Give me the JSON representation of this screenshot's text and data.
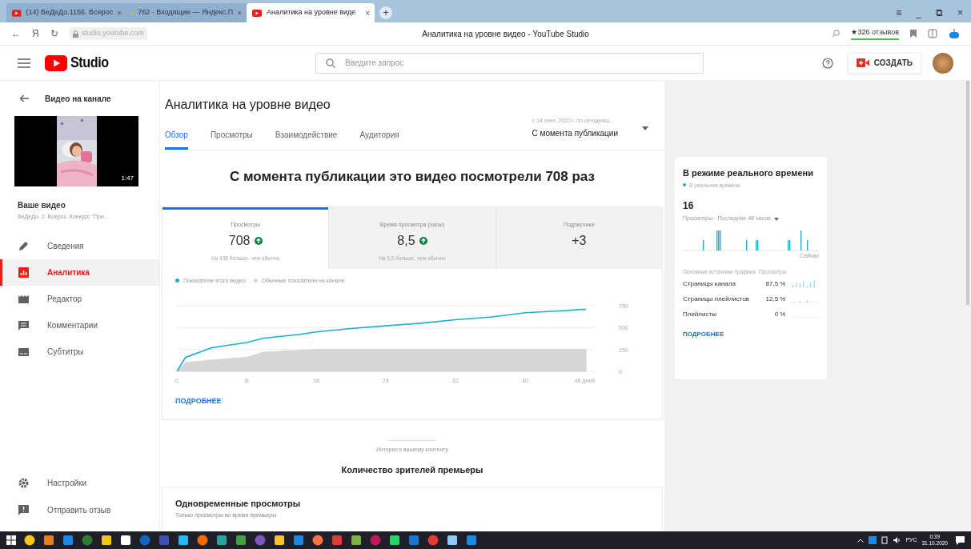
{
  "browser": {
    "tabs": [
      {
        "label": "(14) ВеДеДо.1156. Всерос",
        "selected": false,
        "kind": "youtube"
      },
      {
        "label": "762 · Входящие — Яндекс.П",
        "selected": false,
        "kind": "mail"
      },
      {
        "label": "Аналитика на уровне виде",
        "selected": true,
        "kind": "youtube"
      }
    ],
    "address": "studio.youtube.com",
    "page_title": "Аналитика на уровне видео - YouTube Studio",
    "reviews": "★326 отзывов"
  },
  "header": {
    "logo": "Studio",
    "search": {
      "placeholder": "Введите запрос"
    },
    "create_button": "СОЗДАТЬ"
  },
  "sidebar": {
    "back": "Видео на канале",
    "duration": "1:47",
    "video_label": "Ваше видео",
    "video_title": "ВеДеДо. 2. Всерос. Конкурс \"При...",
    "items": [
      {
        "label": "Сведения",
        "selected": false,
        "kind": "pencil"
      },
      {
        "label": "Аналитика",
        "selected": true,
        "kind": "analytics"
      },
      {
        "label": "Редактор",
        "selected": false,
        "kind": "film"
      },
      {
        "label": "Комментарии",
        "selected": false,
        "kind": "comment"
      },
      {
        "label": "Субтитры",
        "selected": false,
        "kind": "subtitles"
      }
    ],
    "bottom_items": [
      {
        "label": "Настройки",
        "kind": "gear"
      },
      {
        "label": "Отправить отзыв",
        "kind": "feedback"
      }
    ]
  },
  "main": {
    "title": "Аналитика на уровне видео",
    "tabs": [
      {
        "label": "Обзор",
        "selected": true
      },
      {
        "label": "Просмотры",
        "selected": false
      },
      {
        "label": "Взаимодействие",
        "selected": false
      },
      {
        "label": "Аудитория",
        "selected": false
      }
    ],
    "date_range": {
      "hint": "с 14 сент. 2020 г. по сегодняш...",
      "value": "С момента публикации"
    },
    "headline": "С момента публикации это видео посмотрели 708 раз",
    "metrics": [
      {
        "label": "Просмотры",
        "value": "708",
        "trend_up": true,
        "note": "На 438 больше, чем обычно",
        "selected": true
      },
      {
        "label": "Время просмотра (часы)",
        "value": "8,5",
        "trend_up": true,
        "note": "На 3,5 больше, чем обычно",
        "selected": false
      },
      {
        "label": "Подписчики",
        "value": "+3",
        "trend_up": false,
        "selected": false
      }
    ],
    "chart_data": {
      "type": "line",
      "x": [
        0,
        1,
        4,
        8,
        10,
        14,
        16,
        20,
        24,
        28,
        32,
        36,
        40,
        44,
        47
      ],
      "series": [
        {
          "name": "Показатели этого видео",
          "type": "line",
          "color": "#1ab0d0",
          "values": [
            0,
            160,
            270,
            330,
            380,
            420,
            450,
            490,
            520,
            550,
            590,
            620,
            670,
            690,
            710
          ]
        },
        {
          "name": "Обычные показатели на канале",
          "type": "area",
          "color": "#d6d6d6",
          "values": [
            0,
            100,
            130,
            160,
            220,
            240,
            250,
            250,
            250,
            250,
            250,
            250,
            250,
            250,
            250
          ]
        }
      ],
      "xticks": [
        0,
        8,
        16,
        24,
        32,
        40,
        {
          "value": 48,
          "label": "48 дней"
        }
      ],
      "yticks": [
        0,
        250,
        500,
        750
      ],
      "xlim": [
        0,
        48
      ],
      "ylim": [
        0,
        750
      ]
    },
    "more_link": "ПОДРОБНЕЕ",
    "section_label": "Интерес к вашему контенту",
    "section_title": "Количество зрителей премьеры",
    "premiere_card": {
      "title": "Одновременные просмотры",
      "subtitle": "Только просмотры во время премьеры"
    }
  },
  "realtime": {
    "title": "В режиме реального времени",
    "status": "В реальном времени",
    "count": "16",
    "period": "Просмотры · Последние 48 часов",
    "now_label": "Сейчас",
    "columns": [
      "Основные источники трафика",
      "Просмотры"
    ],
    "rows": [
      {
        "source": "Страницы канала",
        "share": "87,5 %"
      },
      {
        "source": "Страницы плейлистов",
        "share": "12,5 %"
      },
      {
        "source": "Плейлисты",
        "share": "0 %"
      }
    ],
    "more_link": "ПОДРОБНЕЕ"
  },
  "browser_controls": {
    "tab_close": "×",
    "new_tab": "+",
    "back": "←",
    "browser_logo": "Я",
    "reload": "↻",
    "window_buttons": [
      "≡",
      "_",
      "⧉",
      "×"
    ]
  },
  "taskbar": {
    "language": "РУС",
    "time": "0:39",
    "date": "31.10.2020"
  }
}
